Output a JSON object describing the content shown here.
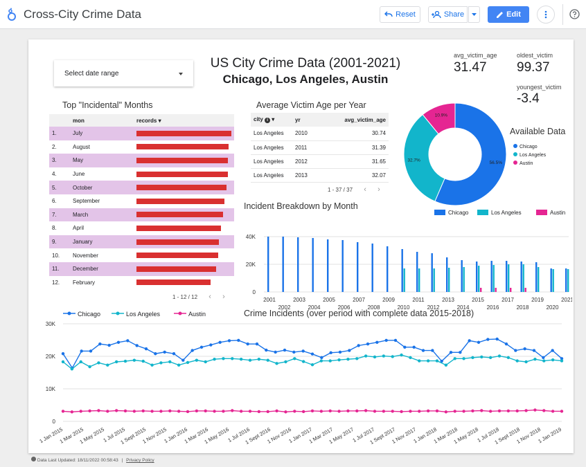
{
  "app": {
    "title": "Cross-City Crime Data",
    "reset_label": "Reset",
    "share_label": "Share",
    "edit_label": "Edit"
  },
  "report": {
    "date_range_placeholder": "Select date range",
    "title": "US City Crime Data (2001-2021)",
    "subtitle": "Chicago, Los Angeles, Austin",
    "scorecards": {
      "avg_label": "avg_victim_age",
      "avg_value": "31.47",
      "oldest_label": "oldest_victim",
      "oldest_value": "99.37",
      "youngest_label": "youngest_victim",
      "youngest_value": "-3.4"
    }
  },
  "top_months": {
    "title": "Top \"Incidental\" Months",
    "col_mon": "mon",
    "col_records": "records",
    "rows": [
      {
        "n": "1.",
        "mon": "July",
        "frac": 1.0
      },
      {
        "n": "2.",
        "mon": "August",
        "frac": 0.97
      },
      {
        "n": "3.",
        "mon": "May",
        "frac": 0.96
      },
      {
        "n": "4.",
        "mon": "June",
        "frac": 0.96
      },
      {
        "n": "5.",
        "mon": "October",
        "frac": 0.95
      },
      {
        "n": "6.",
        "mon": "September",
        "frac": 0.93
      },
      {
        "n": "7.",
        "mon": "March",
        "frac": 0.91
      },
      {
        "n": "8.",
        "mon": "April",
        "frac": 0.89
      },
      {
        "n": "9.",
        "mon": "January",
        "frac": 0.87
      },
      {
        "n": "10.",
        "mon": "November",
        "frac": 0.86
      },
      {
        "n": "11.",
        "mon": "December",
        "frac": 0.84
      },
      {
        "n": "12.",
        "mon": "February",
        "frac": 0.78
      }
    ],
    "pager": "1 - 12 / 12"
  },
  "victim_age": {
    "title": "Average Victim Age per Year",
    "col_city": "city",
    "col_yr": "yr",
    "col_avg": "avg_victim_age",
    "rows": [
      {
        "city": "Los Angeles",
        "yr": "2010",
        "avg": "30.74"
      },
      {
        "city": "Los Angeles",
        "yr": "2011",
        "avg": "31.39"
      },
      {
        "city": "Los Angeles",
        "yr": "2012",
        "avg": "31.65"
      },
      {
        "city": "Los Angeles",
        "yr": "2013",
        "avg": "32.07"
      }
    ],
    "pager": "1 - 37 / 37"
  },
  "donut": {
    "title": "Available Data",
    "legend": [
      "Chicago",
      "Los Angeles",
      "Austin"
    ],
    "slice_labels": [
      "56.5%",
      "32.7%",
      "10.9%"
    ],
    "colors": [
      "#1a73e8",
      "#12b5cb",
      "#e52592"
    ]
  },
  "breakdown": {
    "title": "Incident Breakdown by Month",
    "legend": [
      "Chicago",
      "Los Angeles",
      "Austin"
    ],
    "colors": [
      "#1a73e8",
      "#12b5cb",
      "#e52592"
    ]
  },
  "incidents": {
    "title": "Crime Incidents (over period with complete data 2015-2018)",
    "legend": [
      "Chicago",
      "Los Angeles",
      "Austin"
    ],
    "colors": [
      "#1a73e8",
      "#12b5cb",
      "#e52592"
    ]
  },
  "footer": {
    "updated": "Data Last Updated: 18/11/2022 00:58:43",
    "privacy": "Privacy Policy"
  },
  "chart_data": [
    {
      "type": "pie",
      "title": "Available Data",
      "categories": [
        "Chicago",
        "Los Angeles",
        "Austin"
      ],
      "values": [
        56.5,
        32.7,
        10.9
      ]
    },
    {
      "type": "bar",
      "title": "Incident Breakdown by Month",
      "categories": [
        "2001",
        "2002",
        "2003",
        "2004",
        "2005",
        "2006",
        "2007",
        "2008",
        "2009",
        "2010",
        "2011",
        "2012",
        "2013",
        "2014",
        "2015",
        "2016",
        "2017",
        "2018",
        "2019",
        "2020",
        "2021"
      ],
      "ylim": [
        0,
        40000
      ],
      "y_ticks": [
        "0",
        "20K",
        "40K"
      ],
      "series": [
        {
          "name": "Chicago",
          "values": [
            40000,
            40000,
            39500,
            39000,
            38000,
            37500,
            36000,
            35000,
            33000,
            31000,
            29000,
            28000,
            25000,
            23000,
            22000,
            22500,
            22500,
            22000,
            21500,
            17000,
            17000
          ]
        },
        {
          "name": "Los Angeles",
          "values": [
            0,
            0,
            0,
            0,
            0,
            0,
            0,
            0,
            0,
            17000,
            17000,
            17000,
            17500,
            18000,
            19000,
            19500,
            20000,
            20000,
            18000,
            16500,
            16500
          ]
        },
        {
          "name": "Austin",
          "values": [
            0,
            0,
            0,
            0,
            0,
            0,
            0,
            0,
            0,
            0,
            0,
            0,
            0,
            0,
            3000,
            3000,
            3000,
            3000,
            0,
            0,
            0
          ]
        }
      ]
    },
    {
      "type": "line",
      "title": "Crime Incidents (over period with complete data 2015-2018)",
      "ylim": [
        0,
        30000
      ],
      "y_ticks": [
        "0",
        "10K",
        "20K",
        "30K"
      ],
      "x_tick_labels": [
        "1 Jan 2015",
        "1 Mar 2015",
        "1 May 2015",
        "1 Jul 2015",
        "1 Sept 2015",
        "1 Nov 2015",
        "1 Jan 2016",
        "1 Mar 2016",
        "1 May 2016",
        "1 Jul 2016",
        "1 Sept 2016",
        "1 Nov 2016",
        "1 Jan 2017",
        "1 Mar 2017",
        "1 May 2017",
        "1 Jul 2017",
        "1 Sept 2017",
        "1 Nov 2017",
        "1 Jan 2018",
        "1 Mar 2018",
        "1 May 2018",
        "1 Jul 2018",
        "1 Sept 2018",
        "1 Nov 2018",
        "1 Jan 2019"
      ],
      "series": [
        {
          "name": "Chicago",
          "values": [
            20800,
            16400,
            21600,
            21600,
            23800,
            23400,
            24300,
            24800,
            23300,
            22300,
            20800,
            21300,
            20800,
            18800,
            21800,
            22800,
            23500,
            24300,
            24800,
            24900,
            23800,
            23800,
            21900,
            21300,
            21900,
            21300,
            21600,
            20700,
            19600,
            21100,
            21300,
            21800,
            23300,
            23800,
            24300,
            24900,
            24900,
            22800,
            22800,
            21800,
            21800,
            18500,
            21200,
            21200,
            24800,
            24300,
            25200,
            25300,
            23800,
            21800,
            22300,
            21800,
            19600,
            21800,
            19300
          ]
        },
        {
          "name": "Los Angeles",
          "values": [
            18300,
            16100,
            18300,
            16800,
            18000,
            17300,
            18300,
            18500,
            18800,
            18500,
            17300,
            18000,
            18300,
            17300,
            18100,
            18800,
            18300,
            19100,
            19300,
            19300,
            19100,
            18800,
            19100,
            18800,
            17800,
            18300,
            19300,
            18400,
            17400,
            18600,
            18600,
            18900,
            19100,
            19300,
            20100,
            19800,
            20100,
            19900,
            20400,
            19600,
            18600,
            18600,
            18600,
            17300,
            19300,
            19300,
            19600,
            19800,
            19600,
            20100,
            19600,
            18600,
            18300,
            19100,
            18600,
            18900,
            18600
          ]
        },
        {
          "name": "Austin",
          "values": [
            3100,
            2900,
            3100,
            3200,
            3300,
            3100,
            3300,
            3200,
            3100,
            3200,
            3100,
            3100,
            3200,
            3100,
            3000,
            3200,
            3200,
            3100,
            3100,
            3300,
            3100,
            3100,
            3000,
            3000,
            3200,
            2900,
            3100,
            3000,
            3200,
            3100,
            3200,
            3100,
            3200,
            3200,
            3300,
            3100,
            3100,
            3100,
            3000,
            3100,
            3100,
            3200,
            3200,
            2900,
            3100,
            3100,
            3200,
            3300,
            3100,
            3200,
            3200,
            3200,
            3300,
            3500,
            3300,
            3100,
            3100
          ]
        }
      ]
    }
  ]
}
